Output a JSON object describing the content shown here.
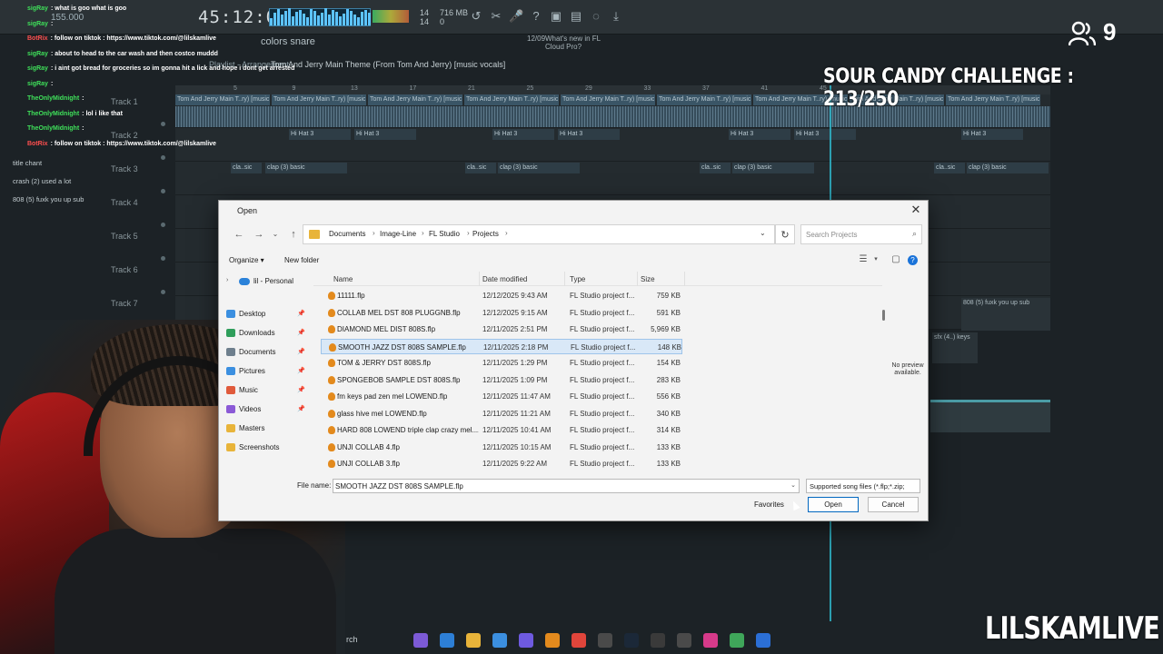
{
  "fl": {
    "clock": "45:12:00",
    "tempo": "155.000",
    "cpu": [
      "14",
      "14"
    ],
    "mem": [
      "716 MB",
      "0"
    ],
    "snap_label": "colors snare",
    "news_date": "12/09",
    "news": [
      "What's new in FL",
      "Cloud Pro?"
    ],
    "breadcrumb_playlist": "Playlist - Arrangement",
    "breadcrumb_song": "Tom And Jerry Main Theme (From Tom And Jerry) [music vocals]",
    "ruler_marks": [
      "5",
      "9",
      "13",
      "17",
      "21",
      "25",
      "29",
      "33",
      "37",
      "41",
      "45"
    ],
    "tracks": [
      "Track 1",
      "Track 2",
      "Track 3",
      "Track 4",
      "Track 5",
      "Track 6",
      "Track 7"
    ],
    "vocal_clip": "Tom And Jerry Main T..ry) [music vocals]",
    "hat_clip": "Hi Hat 3",
    "clap_clip": "clap (3) basic",
    "clap_short": "cla..sic",
    "side_clip1": "808 (5) fuxk you up sub",
    "side_clip2": "sfx (4..) keys"
  },
  "chat": [
    {
      "user": "sigRay",
      "msg": ": what is goo what is goo",
      "bot": false
    },
    {
      "user": "sigRay",
      "msg": ":",
      "bot": false
    },
    {
      "user": "BotRix",
      "msg": ": follow on tiktok : https://www.tiktok.com/@lilskamlive",
      "bot": true
    },
    {
      "user": "sigRay",
      "msg": ": about to head to the car wash and then costco muddd",
      "bot": false
    },
    {
      "user": "sigRay",
      "msg": ": i aint got bread for groceries so im gonna hit a lick and hope i dont get arrested",
      "bot": false
    },
    {
      "user": "sigRay",
      "msg": ":",
      "bot": false
    },
    {
      "user": "TheOnlyMidnight",
      "msg": ":",
      "bot": false
    },
    {
      "user": "TheOnlyMidnight",
      "msg": ": lol i like that",
      "bot": false
    },
    {
      "user": "TheOnlyMidnight",
      "msg": ":",
      "bot": false
    },
    {
      "user": "BotRix",
      "msg": ": follow on tiktok : https://www.tiktok.com/@lilskamlive",
      "bot": true
    }
  ],
  "side_items": [
    "title chant",
    "crash (2) used a lot",
    "808 (5) fuxk you up sub"
  ],
  "overlay": {
    "viewers": "9",
    "challenge": "SOUR CANDY CHALLENGE : 213/250",
    "brand": "LILSKAMLIVE"
  },
  "taskbar": {
    "search": "rch"
  },
  "dialog": {
    "title": "Open",
    "path": [
      "Documents",
      "Image-Line",
      "FL Studio",
      "Projects"
    ],
    "search_placeholder": "Search Projects",
    "organize": "Organize ▾",
    "new_folder": "New folder",
    "nav_personal": "lil - Personal",
    "nav_items": [
      {
        "label": "Desktop",
        "color": "#3b8fe0"
      },
      {
        "label": "Downloads",
        "color": "#2f9e5b"
      },
      {
        "label": "Documents",
        "color": "#6e7f8d"
      },
      {
        "label": "Pictures",
        "color": "#3b8fe0"
      },
      {
        "label": "Music",
        "color": "#e05a3b"
      },
      {
        "label": "Videos",
        "color": "#8b5ad6"
      },
      {
        "label": "Masters",
        "color": "#e8b43a"
      },
      {
        "label": "Screenshots",
        "color": "#e8b43a"
      }
    ],
    "columns": {
      "name": "Name",
      "date": "Date modified",
      "type": "Type",
      "size": "Size"
    },
    "files": [
      {
        "name": "11111.flp",
        "date": "12/12/2025 9:43 AM",
        "type": "FL Studio project f...",
        "size": "759 KB"
      },
      {
        "name": "COLLAB MEL DST 808 PLUGGNB.flp",
        "date": "12/12/2025 9:15 AM",
        "type": "FL Studio project f...",
        "size": "591 KB"
      },
      {
        "name": "DIAMOND MEL DIST 808S.flp",
        "date": "12/11/2025 2:51 PM",
        "type": "FL Studio project f...",
        "size": "5,969 KB"
      },
      {
        "name": "SMOOTH JAZZ DST 808S SAMPLE.flp",
        "date": "12/11/2025 2:18 PM",
        "type": "FL Studio project f...",
        "size": "148 KB",
        "selected": true
      },
      {
        "name": "TOM & JERRY DST 808S.flp",
        "date": "12/11/2025 1:29 PM",
        "type": "FL Studio project f...",
        "size": "154 KB"
      },
      {
        "name": "SPONGEBOB SAMPLE DST 808S.flp",
        "date": "12/11/2025 1:09 PM",
        "type": "FL Studio project f...",
        "size": "283 KB"
      },
      {
        "name": "fm keys pad zen mel LOWEND.flp",
        "date": "12/11/2025 11:47 AM",
        "type": "FL Studio project f...",
        "size": "556 KB"
      },
      {
        "name": "glass hive mel LOWEND.flp",
        "date": "12/11/2025 11:21 AM",
        "type": "FL Studio project f...",
        "size": "340 KB"
      },
      {
        "name": "HARD 808 LOWEND triple clap crazy mel....",
        "date": "12/11/2025 10:41 AM",
        "type": "FL Studio project f...",
        "size": "314 KB"
      },
      {
        "name": "UNJI COLLAB 4.flp",
        "date": "12/11/2025 10:15 AM",
        "type": "FL Studio project f...",
        "size": "133 KB"
      },
      {
        "name": "UNJI COLLAB 3.flp",
        "date": "12/11/2025 9:22 AM",
        "type": "FL Studio project f...",
        "size": "133 KB"
      }
    ],
    "preview": "No preview available.",
    "filename_label": "File name:",
    "filename_value": "SMOOTH JAZZ DST 808S SAMPLE.flp",
    "filetype": "Supported song files (*.flp;*.zip;",
    "favorites": "Favorites",
    "open": "Open",
    "cancel": "Cancel"
  }
}
